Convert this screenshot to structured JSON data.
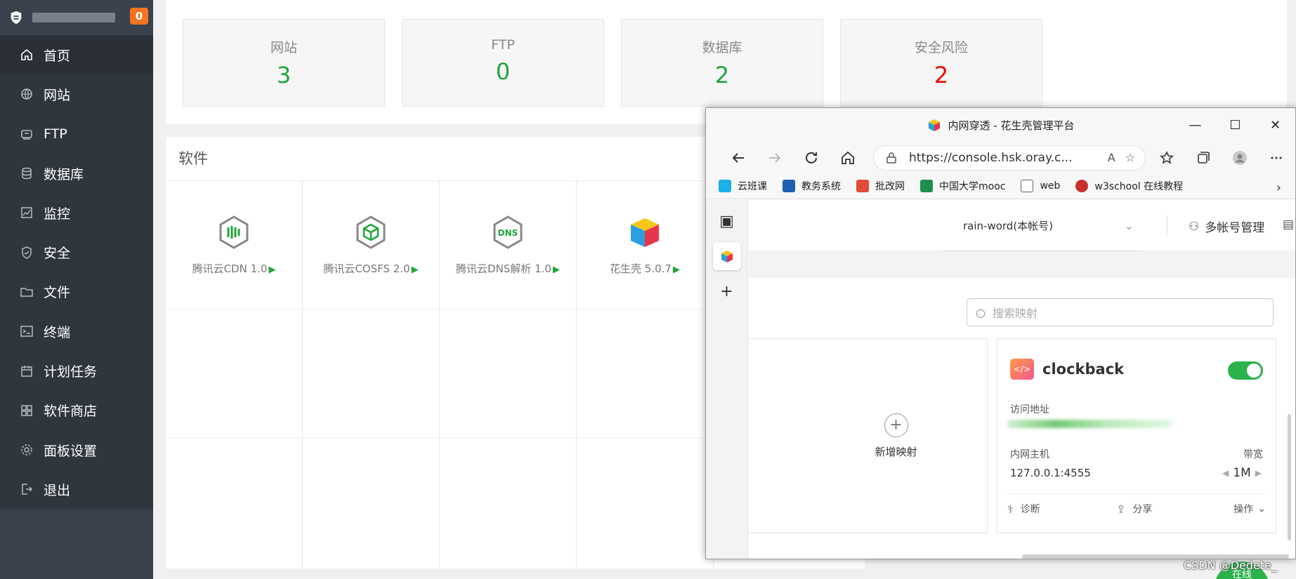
{
  "sidebar": {
    "badge": "0",
    "items": [
      {
        "label": "首页",
        "icon": "home-icon",
        "active": true
      },
      {
        "label": "网站",
        "icon": "globe-icon"
      },
      {
        "label": "FTP",
        "icon": "ftp-icon"
      },
      {
        "label": "数据库",
        "icon": "database-icon"
      },
      {
        "label": "监控",
        "icon": "monitor-icon"
      },
      {
        "label": "安全",
        "icon": "shield-icon"
      },
      {
        "label": "文件",
        "icon": "folder-icon"
      },
      {
        "label": "终端",
        "icon": "terminal-icon"
      },
      {
        "label": "计划任务",
        "icon": "calendar-icon"
      },
      {
        "label": "软件商店",
        "icon": "grid-icon"
      },
      {
        "label": "面板设置",
        "icon": "gear-icon"
      },
      {
        "label": "退出",
        "icon": "logout-icon"
      }
    ]
  },
  "stats": [
    {
      "label": "网站",
      "value": "3",
      "color": "#20a53a"
    },
    {
      "label": "FTP",
      "value": "0",
      "color": "#20a53a"
    },
    {
      "label": "数据库",
      "value": "2",
      "color": "#20a53a"
    },
    {
      "label": "安全风险",
      "value": "2",
      "color": "#ef0808"
    }
  ],
  "software": {
    "title": "软件",
    "items": [
      {
        "name": "腾讯云CDN 1.0",
        "icon": "cdn-hex-icon"
      },
      {
        "name": "腾讯云COSFS 2.0",
        "icon": "cube-hex-icon"
      },
      {
        "name": "腾讯云DNS解析 1.0",
        "icon": "dns-hex-icon"
      },
      {
        "name": "花生壳 5.0.7",
        "icon": "oray-cube-icon"
      }
    ]
  },
  "browser": {
    "title": "内网穿透 - 花生壳管理平台",
    "url": "https://console.hsk.oray.c...",
    "favorites": [
      {
        "label": "云班课",
        "color": "#1ab0e8"
      },
      {
        "label": "教务系统",
        "color": "#1e5fb4"
      },
      {
        "label": "批改网",
        "color": "#e04b3a"
      },
      {
        "label": "中国大学mooc",
        "color": "#1f8f4e"
      },
      {
        "label": "web",
        "color": "#666666"
      },
      {
        "label": "w3school 在线教程",
        "color": "#c8302c"
      }
    ],
    "account": "rain-word(本帐号)",
    "account_manager": "多帐号管理",
    "search_placeholder": "搜索映射",
    "add_mapping": "新增映射",
    "mapping": {
      "name": "clockback",
      "access_label": "访问地址",
      "host_label": "内网主机",
      "host": "127.0.0.1:4555",
      "bandwidth_label": "带宽",
      "bandwidth": "1M",
      "diagnose": "诊断",
      "share": "分享",
      "operate": "操作"
    }
  },
  "watermark": "CSDN @Dedete_",
  "online": "在线",
  "colors": {
    "accent": "#20a53a",
    "sidebar": "#39424d",
    "danger": "#ef0808"
  }
}
